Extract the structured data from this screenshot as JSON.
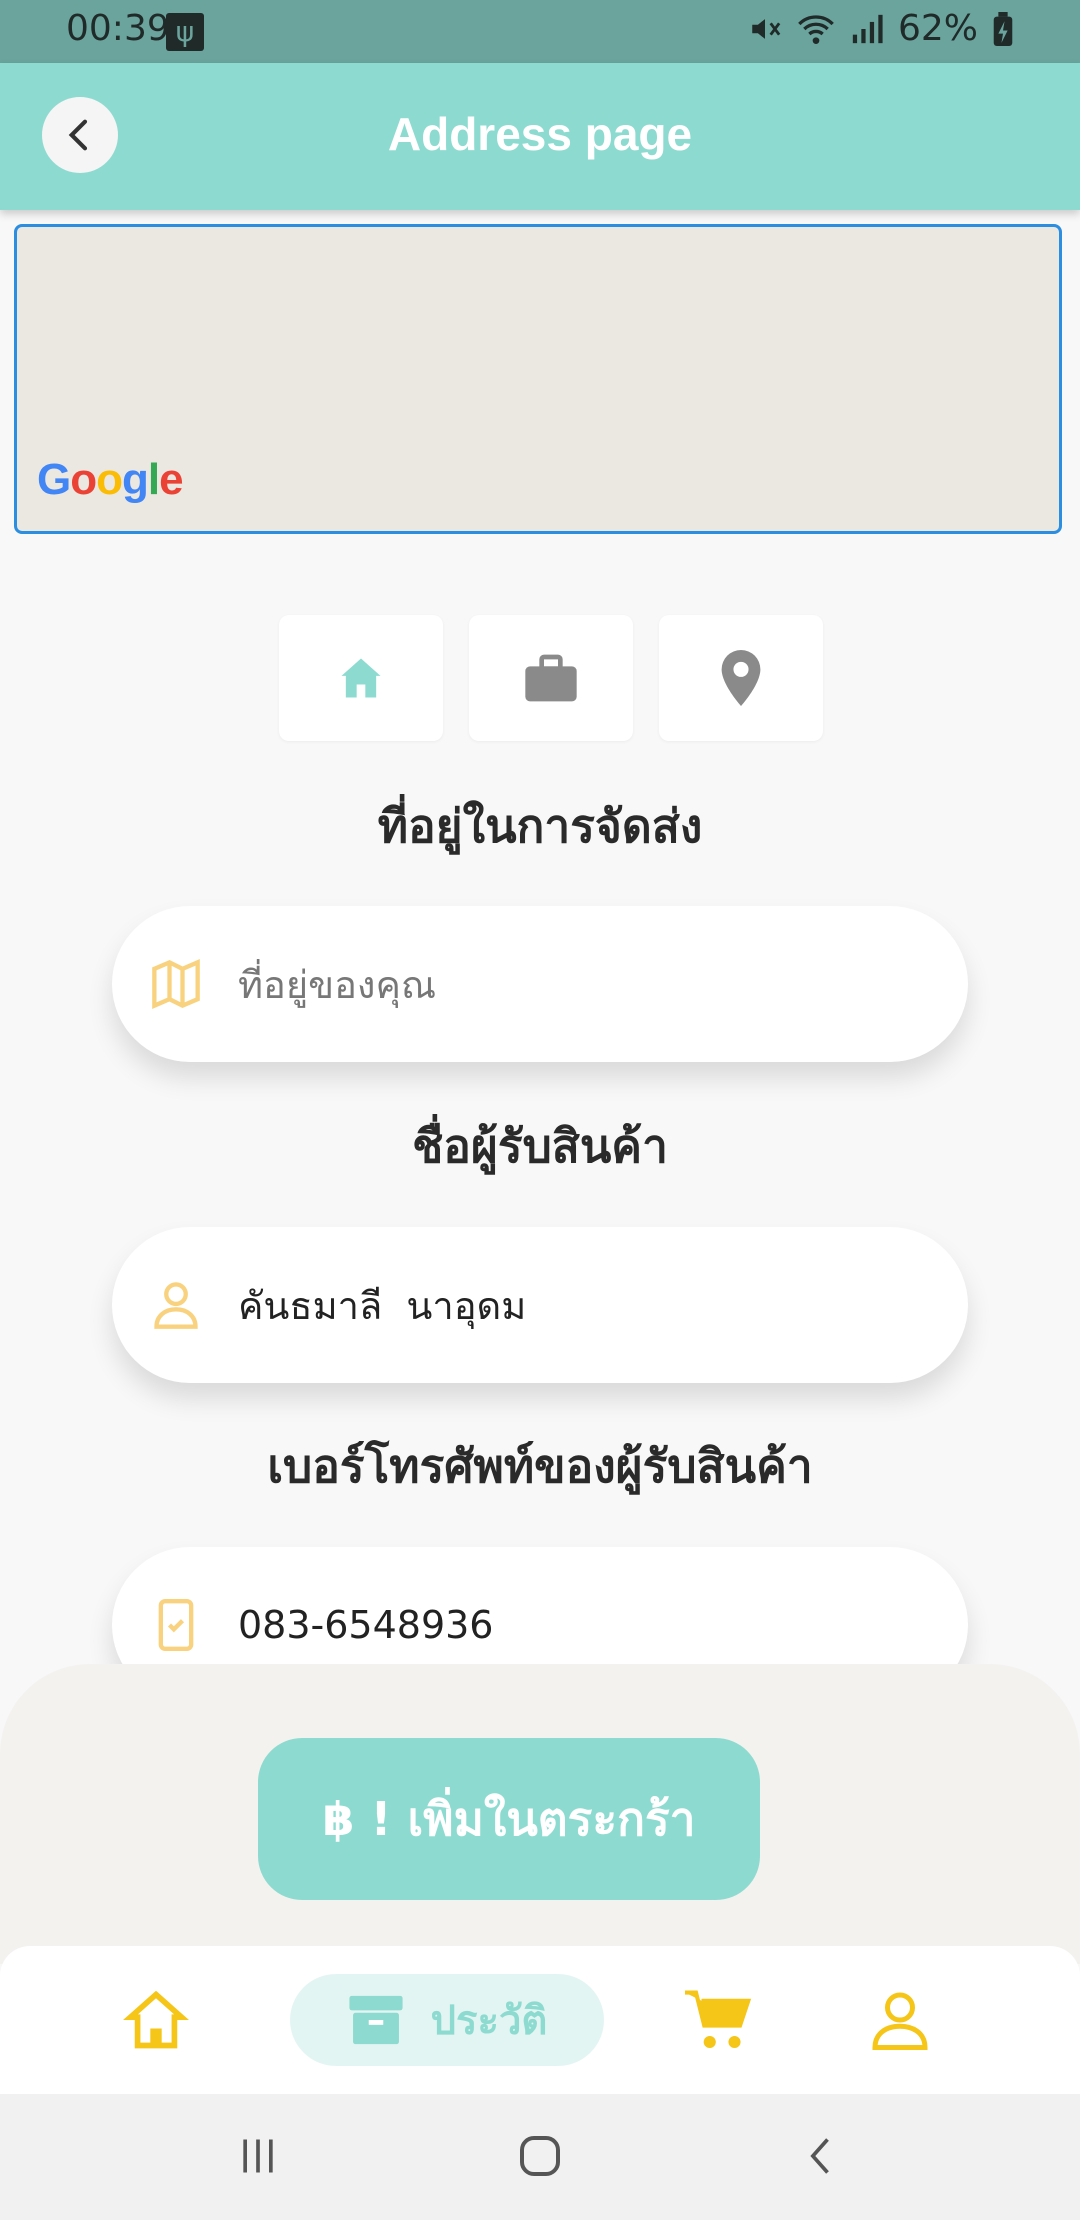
{
  "status": {
    "time": "00:39",
    "battery": "62%"
  },
  "header": {
    "title": "Address page"
  },
  "map": {
    "logo": "Google"
  },
  "address_types": [
    {
      "icon": "home-icon",
      "color": "#8ddbd0",
      "selected": true
    },
    {
      "icon": "briefcase-icon",
      "color": "#8a8a8a",
      "selected": false
    },
    {
      "icon": "location-pin-icon",
      "color": "#8a8a8a",
      "selected": false
    }
  ],
  "form": {
    "address_label": "ที่อยู่ในการจัดส่ง",
    "address_placeholder": "ที่อยู่ของคุณ",
    "address_value": "",
    "name_label": "ชื่อผู้รับสินค้า",
    "name_value": "คันธมาลี  นาอุดม",
    "phone_label": "เบอร์โทรศัพท์ของผู้รับสินค้า",
    "phone_value": "083-6548936"
  },
  "actions": {
    "add_to_cart": "฿ ! เพิ่มในตระกร้า"
  },
  "nav": {
    "history_label": "ประวัติ"
  },
  "colors": {
    "accent": "#8ddbd0",
    "icon_yellow": "#f5c518",
    "field_icon": "#f9d27f"
  }
}
